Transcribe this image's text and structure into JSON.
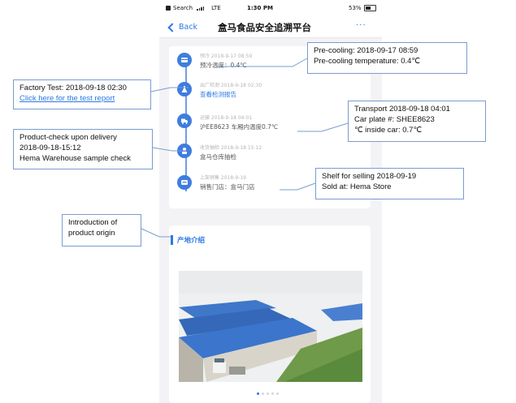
{
  "status_bar": {
    "carrier": "Search",
    "network": "LTE",
    "time": "1:30 PM",
    "battery": "53%"
  },
  "nav": {
    "back_label": "Back",
    "title": "盒马食品安全追溯平台",
    "more": "···"
  },
  "timeline": [
    {
      "meta": "预冷 2018-9-17 08:59",
      "value": "预冷温度：0.4℃",
      "icon": "snowflake-icon",
      "is_link": false
    },
    {
      "meta": "出厂检测 2018-9-18 02:30",
      "value": "查看检测报告",
      "icon": "flask-icon",
      "is_link": true
    },
    {
      "meta": "运输 2018-9-18 04:01",
      "value": "沪EE8623 车厢内温度0.7℃",
      "icon": "truck-icon",
      "is_link": false
    },
    {
      "meta": "收货抽检 2018-9-18 15:12",
      "value": "盒马仓库抽检",
      "icon": "inspection-icon",
      "is_link": false
    },
    {
      "meta": "上架销售 2018-9-19",
      "value": "销售门店：盒马门店",
      "icon": "store-icon",
      "is_link": false
    }
  ],
  "origin": {
    "title": "产地介绍"
  },
  "callouts": {
    "precooling": [
      "Pre-cooling: 2018-09-17 08:59",
      "Pre-cooling temperature: 0.4℃"
    ],
    "factory": {
      "line1": "Factory Test: 2018-09-18 02:30",
      "link": "Click here for the test report"
    },
    "transport": [
      "Transport 2018-09-18 04:01",
      "Car plate #: SHEE8623",
      "℃ inside car: 0.7℃"
    ],
    "product_check": [
      "Product-check upon delivery",
      "2018-09-18-15:12",
      "Hema Warehouse sample check"
    ],
    "shelf": [
      "Shelf for selling 2018-09-19",
      "Sold at: Hema Store"
    ],
    "origin": [
      "Introduction of",
      "product origin"
    ]
  },
  "colors": {
    "accent": "#2b78e4",
    "callout_border": "#7a9ccf",
    "timeline_node": "#3e7de0"
  }
}
